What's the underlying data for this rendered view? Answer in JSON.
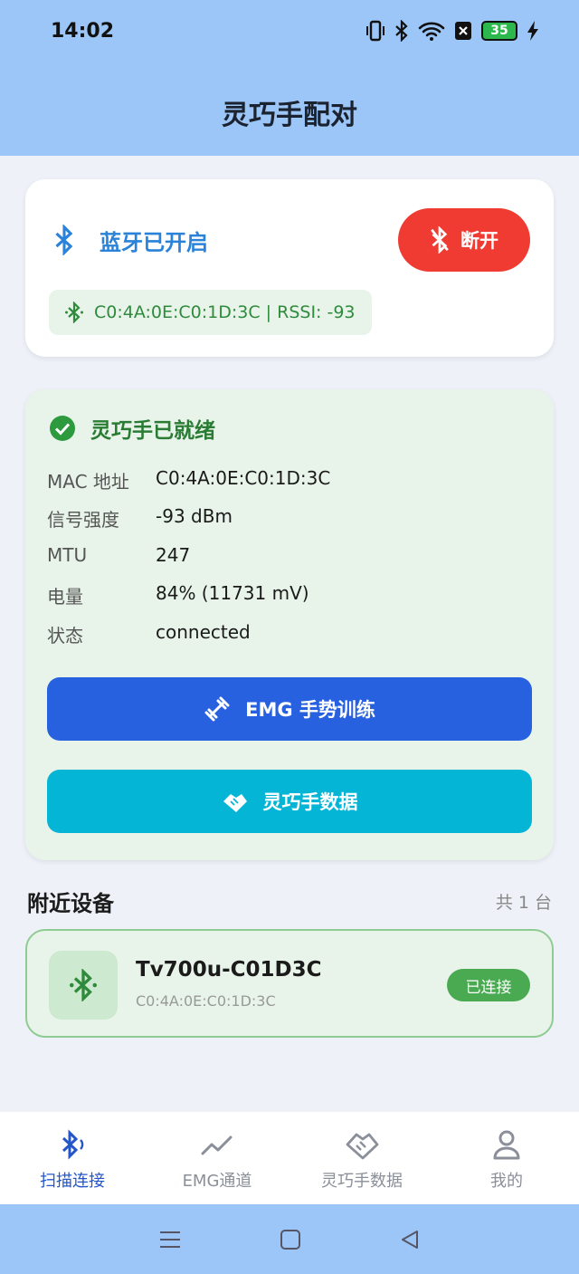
{
  "status_bar": {
    "time": "14:02",
    "battery": "35",
    "icons": [
      "vibrate-icon",
      "bluetooth-icon",
      "wifi-icon",
      "sim-x-icon",
      "battery-icon",
      "charging-icon"
    ]
  },
  "header": {
    "title": "灵巧手配对"
  },
  "bluetooth_card": {
    "status": "蓝牙已开启",
    "disconnect_label": "断开",
    "device_info": "C0:4A:0E:C0:1D:3C | RSSI: -93"
  },
  "ready_card": {
    "title": "灵巧手已就绪",
    "rows": [
      {
        "label": "MAC 地址",
        "value": "C0:4A:0E:C0:1D:3C"
      },
      {
        "label": "信号强度",
        "value": "-93 dBm"
      },
      {
        "label": "MTU",
        "value": "247"
      },
      {
        "label": "电量",
        "value": "84% (11731 mV)"
      },
      {
        "label": "状态",
        "value": "connected"
      }
    ],
    "emg_button": "EMG 手势训练",
    "data_button": "灵巧手数据"
  },
  "nearby": {
    "title": "附近设备",
    "count": "共 1 台",
    "devices": [
      {
        "name": "Tv700u-C01D3C",
        "mac": "C0:4A:0E:C0:1D:3C",
        "badge": "已连接"
      }
    ]
  },
  "bottom_nav": {
    "items": [
      {
        "label": "扫描连接",
        "active": true
      },
      {
        "label": "EMG通道",
        "active": false
      },
      {
        "label": "灵巧手数据",
        "active": false
      },
      {
        "label": "我的",
        "active": false
      }
    ]
  },
  "colors": {
    "header_bg": "#9cc6f7",
    "bluetooth_blue": "#2a83d8",
    "disconnect_red": "#ef3b32",
    "ready_green": "#2a7c35",
    "emg_blue": "#2761e0",
    "data_cyan": "#05b5d6",
    "badge_green": "#4aaa52",
    "nav_active": "#2456c9"
  }
}
